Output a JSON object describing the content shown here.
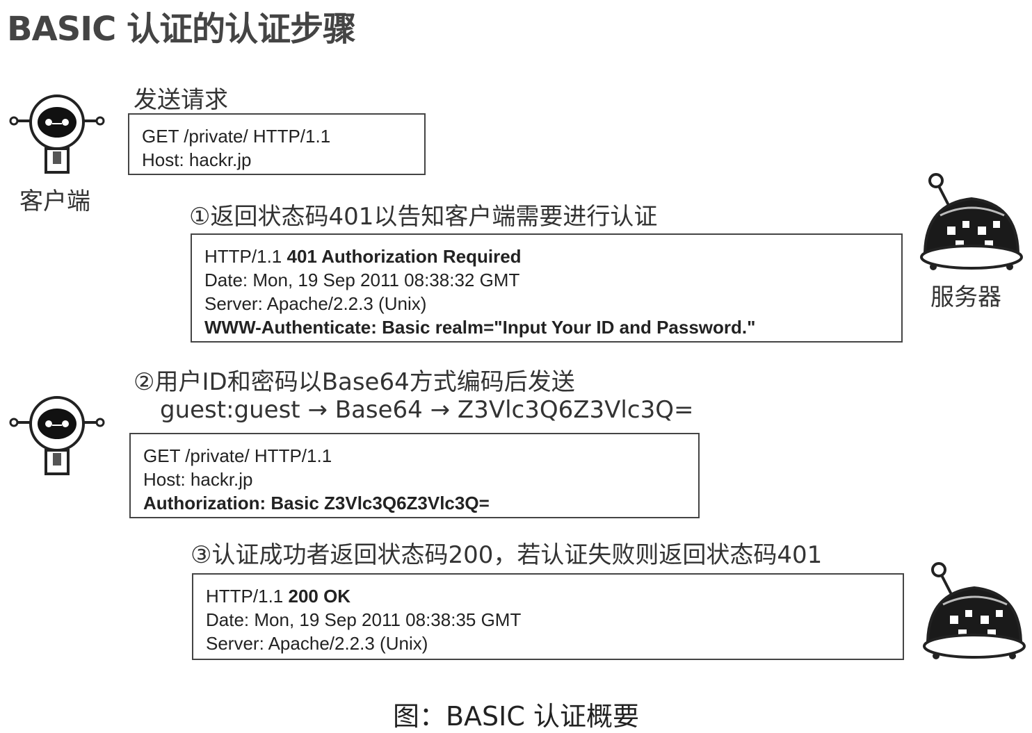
{
  "title": "BASIC 认证的认证步骤",
  "roles": {
    "client": "客户端",
    "server": "服务器"
  },
  "step0": {
    "label": "发送请求",
    "lines": [
      "GET /private/ HTTP/1.1",
      "Host: hackr.jp"
    ]
  },
  "step1": {
    "label": "①返回状态码401以告知客户端需要进行认证",
    "status_prefix": "HTTP/1.1 ",
    "status_text": "401 Authorization Required",
    "lines": [
      "Date: Mon, 19 Sep 2011 08:38:32 GMT",
      "Server: Apache/2.2.3 (Unix)"
    ],
    "www_auth": "WWW-Authenticate: Basic realm=\"Input Your ID and Password.\""
  },
  "step2": {
    "label": "②用户ID和密码以Base64方式编码后发送",
    "encoding": "guest:guest → Base64 → Z3Vlc3Q6Z3Vlc3Q=",
    "lines": [
      "GET /private/ HTTP/1.1",
      "Host: hackr.jp"
    ],
    "auth": "Authorization: Basic Z3Vlc3Q6Z3Vlc3Q="
  },
  "step3": {
    "label": "③认证成功者返回状态码200，若认证失败则返回状态码401",
    "status_prefix": "HTTP/1.1 ",
    "status_text": "200 OK",
    "lines": [
      "Date: Mon, 19 Sep 2011 08:38:35 GMT",
      "Server: Apache/2.2.3 (Unix)"
    ]
  },
  "caption": "图：BASIC 认证概要"
}
